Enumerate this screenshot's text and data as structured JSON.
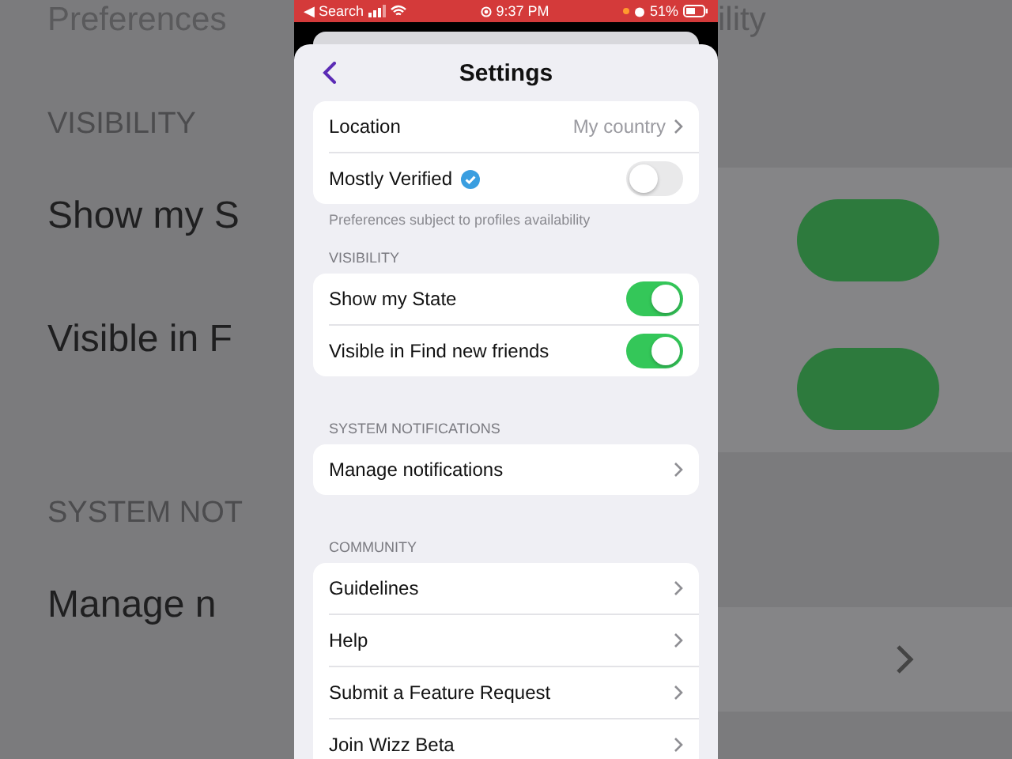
{
  "backdrop": {
    "left_texts": [
      {
        "kind": "header",
        "text": "Preferences"
      },
      {
        "kind": "section",
        "text": "VISIBILITY"
      },
      {
        "kind": "row",
        "text": "Show my S"
      },
      {
        "kind": "row",
        "text": "Visible in F"
      },
      {
        "kind": "section",
        "text": "SYSTEM NOT"
      },
      {
        "kind": "row",
        "text": "Manage n"
      }
    ],
    "right_header": "ility"
  },
  "status_bar": {
    "back_label": "◀ Search",
    "time": "9:37 PM",
    "battery": "51%"
  },
  "header": {
    "title": "Settings"
  },
  "groups": [
    {
      "rows": [
        {
          "kind": "value",
          "label": "Location",
          "value": "My country"
        },
        {
          "kind": "toggle",
          "label": "Mostly Verified",
          "verified": true,
          "on": false
        }
      ],
      "footnote": "Preferences subject to profiles availability"
    },
    {
      "title": "VISIBILITY",
      "rows": [
        {
          "kind": "toggle",
          "label": "Show my State",
          "on": true
        },
        {
          "kind": "toggle",
          "label": "Visible in Find new friends",
          "on": true
        }
      ]
    },
    {
      "title": "SYSTEM NOTIFICATIONS",
      "rows": [
        {
          "kind": "link",
          "label": "Manage notifications"
        }
      ]
    },
    {
      "title": "COMMUNITY",
      "rows": [
        {
          "kind": "link",
          "label": "Guidelines"
        },
        {
          "kind": "link",
          "label": "Help"
        },
        {
          "kind": "link",
          "label": "Submit a Feature Request"
        },
        {
          "kind": "link",
          "label": "Join Wizz Beta"
        }
      ]
    }
  ]
}
